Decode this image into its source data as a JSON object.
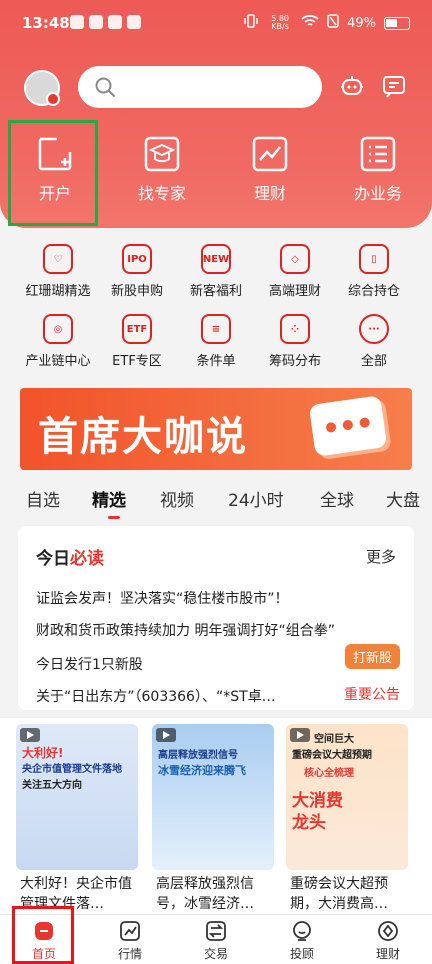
{
  "status_bar": {
    "time": "13:48",
    "net_speed_top": "5.80",
    "net_speed_bottom": "KB/s",
    "battery": "49%"
  },
  "search": {
    "placeholder": ""
  },
  "quick_actions": [
    {
      "label": "开户",
      "icon": "add-account-icon"
    },
    {
      "label": "找专家",
      "icon": "graduation-cap-icon"
    },
    {
      "label": "理财",
      "icon": "chart-icon"
    },
    {
      "label": "办业务",
      "icon": "list-icon"
    }
  ],
  "grid": [
    {
      "label": "红珊瑚精选",
      "icon": "heart-badge-icon",
      "glyph": ""
    },
    {
      "label": "新股申购",
      "icon": "ipo-icon",
      "glyph": "IPO"
    },
    {
      "label": "新客福利",
      "icon": "new-icon",
      "glyph": "NEW"
    },
    {
      "label": "高端理财",
      "icon": "diamond-icon",
      "glyph": ""
    },
    {
      "label": "综合持仓",
      "icon": "holdings-icon",
      "glyph": ""
    },
    {
      "label": "产业链中心",
      "icon": "chain-icon",
      "glyph": ""
    },
    {
      "label": "ETF专区",
      "icon": "etf-icon",
      "glyph": "ETF"
    },
    {
      "label": "条件单",
      "icon": "condition-order-icon",
      "glyph": ""
    },
    {
      "label": "筹码分布",
      "icon": "dice-icon",
      "glyph": ""
    },
    {
      "label": "全部",
      "icon": "more-icon",
      "glyph": "···"
    }
  ],
  "banner": {
    "title": "首席大咖说"
  },
  "tabs": [
    "自选",
    "精选",
    "视频",
    "24小时",
    "全球",
    "大盘"
  ],
  "active_tab": "精选",
  "daily": {
    "title_prefix": "今日",
    "title_highlight": "必读",
    "more": "更多",
    "news": [
      "证监会发声！坚决落实“稳住楼市股市”！",
      "财政和货币政策持续加力 明年强调打好“组合拳”",
      "今日发行1只新股",
      "关于“日出东方”（603366）、“*ST卓…"
    ],
    "new_stock_button": "打新股",
    "notice_tag": "重要公告"
  },
  "videos": [
    {
      "title": "大利好！央企市值管理文件落…",
      "thumb_lines": [
        "大利好!",
        "央企市值管理文件落地",
        "关注五大方向"
      ]
    },
    {
      "title": "高层释放强烈信号，冰雪经济…",
      "thumb_lines": [
        "高层释放强烈信号",
        "冰雪经济迎来腾飞"
      ]
    },
    {
      "title": "重磅会议大超预期，大消费高…",
      "thumb_lines": [
        "空间巨大",
        "重磅会议大超预期",
        "核心全梳理",
        "大消费",
        "龙头"
      ]
    }
  ],
  "bottom_nav": [
    {
      "label": "首页",
      "icon": "home-icon",
      "active": true
    },
    {
      "label": "行情",
      "icon": "market-icon",
      "active": false
    },
    {
      "label": "交易",
      "icon": "trade-icon",
      "active": false
    },
    {
      "label": "投顾",
      "icon": "advisor-icon",
      "active": false
    },
    {
      "label": "理财",
      "icon": "finance-icon",
      "active": false
    }
  ],
  "colors": {
    "brand_red": "#e8362f",
    "header_red": "#ee5a55",
    "accent_orange": "#f0823a"
  }
}
